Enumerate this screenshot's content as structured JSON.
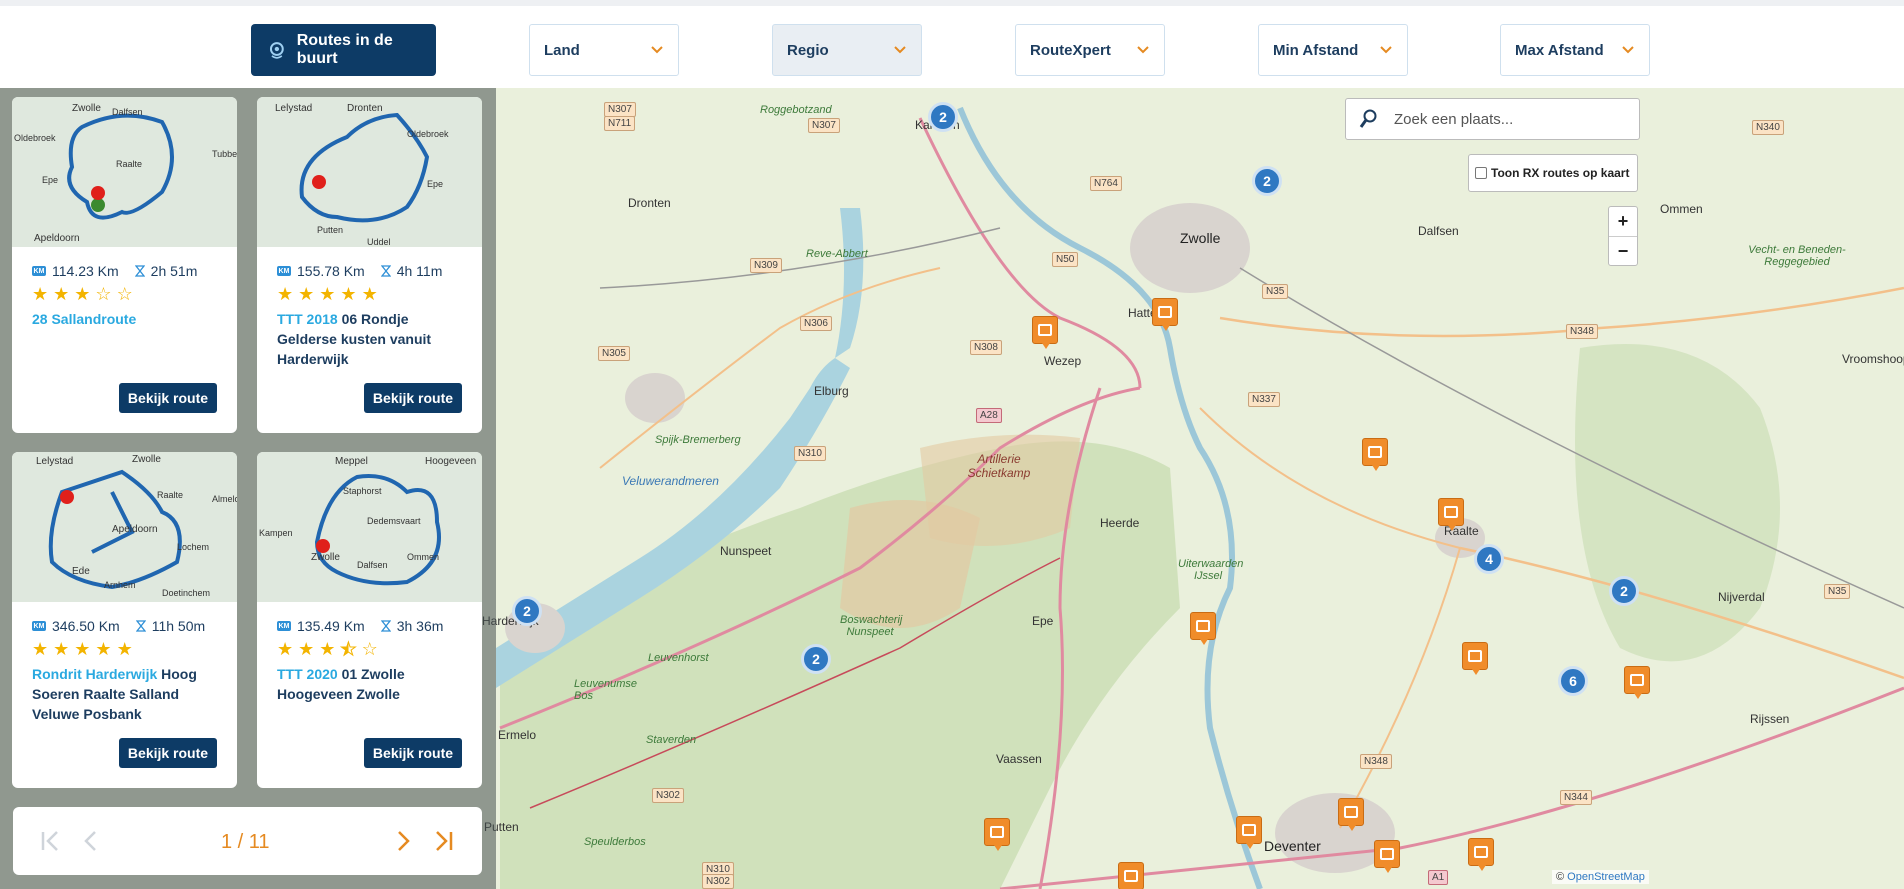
{
  "filters": {
    "nearby_label": "Routes in de buurt",
    "dropdowns": [
      {
        "label": "Land"
      },
      {
        "label": "Regio"
      },
      {
        "label": "RouteXpert"
      },
      {
        "label": "Min Afstand"
      },
      {
        "label": "Max Afstand"
      }
    ]
  },
  "routes": [
    {
      "km": "114.23 Km",
      "duration": "2h 51m",
      "stars": 3,
      "title_prefix": "28 Sallandroute",
      "title_rest": "",
      "button": "Bekijk route",
      "thumb_labels": [
        "Zwolle",
        "Dalfsen",
        "Oldebroek",
        "Raalte",
        "Epe",
        "Tubbe",
        "Apeldoorn"
      ]
    },
    {
      "km": "155.78 Km",
      "duration": "4h 11m",
      "stars": 5,
      "title_prefix": "TTT 2018",
      "title_rest": "06 Rondje Gelderse kusten vanuit Harderwijk",
      "button": "Bekijk route",
      "thumb_labels": [
        "Lelystad",
        "Dronten",
        "Oldebroek",
        "Epe",
        "Putten",
        "Uddel"
      ]
    },
    {
      "km": "346.50 Km",
      "duration": "11h 50m",
      "stars": 5,
      "title_prefix": "Rondrit Harderwijk",
      "title_rest": "Hoog Soeren Raalte Salland Veluwe Posbank",
      "button": "Bekijk route",
      "thumb_labels": [
        "Lelystad",
        "Zwolle",
        "Raalte",
        "Almelo",
        "Apeldoorn",
        "Lochem",
        "Ede",
        "Arnhem",
        "Doetinchem"
      ]
    },
    {
      "km": "135.49 Km",
      "duration": "3h 36m",
      "stars": 3.5,
      "title_prefix": "TTT 2020",
      "title_rest": "01 Zwolle Hoogeveen Zwolle",
      "button": "Bekijk route",
      "thumb_labels": [
        "Meppel",
        "Hoogeveen",
        "Staphorst",
        "Dedemsvaart",
        "Zwolle",
        "Dalfsen",
        "Ommen",
        "Kampen"
      ]
    }
  ],
  "pager": {
    "text": "1 / 11"
  },
  "search": {
    "placeholder": "Zoek een plaats..."
  },
  "rx_toggle": {
    "label": "Toon RX routes op kaart"
  },
  "zoom": {
    "in": "+",
    "out": "−"
  },
  "attribution": {
    "prefix": "©",
    "source": "OpenStreetMap"
  },
  "map": {
    "places": [
      "Kampen",
      "Dronten",
      "Zwolle",
      "Dalfsen",
      "Ommen",
      "Hattem",
      "Wezep",
      "Elburg",
      "Nunspeet",
      "Heerde",
      "Raalte",
      "Nijverdal",
      "Epe",
      "Harderwijk",
      "Ermelo",
      "Vaassen",
      "Putten",
      "Deventer",
      "Rijssen",
      "Vroomshoop"
    ],
    "nature": [
      "Roggebotzand",
      "Reve-Abbert",
      "Spijk-Bremerberg",
      "Veluwerandmeren",
      "Boswachterij Nunspeet",
      "Leuvenhorst",
      "Leuvenumse Bos",
      "Staverden",
      "Speulderbos",
      "Vecht- en Beneden-Reggegebied",
      "Uiterwaarden IJssel"
    ],
    "military": "Artillerie Schietkamp",
    "roads": [
      "N307",
      "N711",
      "N307",
      "N764",
      "N340",
      "N309",
      "N50",
      "N35",
      "N306",
      "N308",
      "N305",
      "A28",
      "N348",
      "N337",
      "N310",
      "N35",
      "N348",
      "N302",
      "N344",
      "N310",
      "N302",
      "A1"
    ],
    "clusters": [
      "2",
      "2",
      "4",
      "2",
      "2",
      "2",
      "6"
    ]
  }
}
